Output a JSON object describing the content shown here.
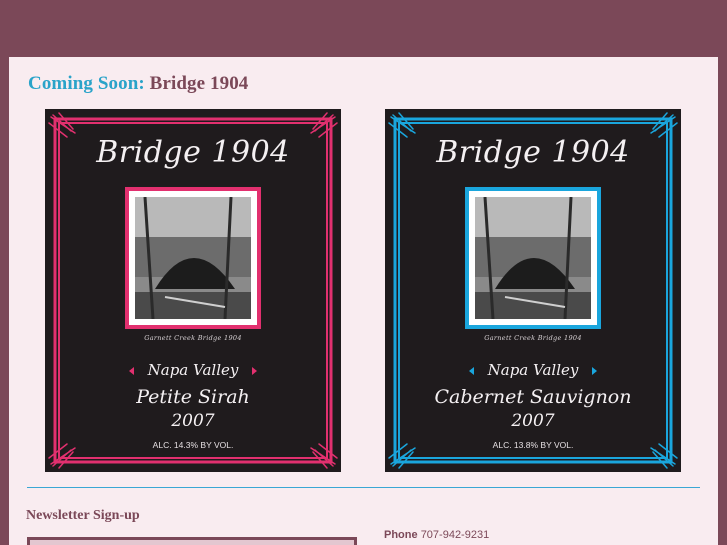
{
  "heading": {
    "prefix": "Coming Soon:",
    "name": "Bridge 1904"
  },
  "labels": [
    {
      "title": "Bridge 1904",
      "caption": "Garnett Creek Bridge 1904",
      "region": "Napa Valley",
      "varietal": "Petite Sirah",
      "vintage": "2007",
      "alc": "ALC. 14.3% BY VOL.",
      "accent": "#e2306f"
    },
    {
      "title": "Bridge 1904",
      "caption": "Garnett Creek Bridge 1904",
      "region": "Napa Valley",
      "varietal": "Cabernet Sauvignon",
      "vintage": "2007",
      "alc": "ALC. 13.8% BY VOL.",
      "accent": "#1aa6dd"
    }
  ],
  "newsletter": {
    "title": "Newsletter Sign-up"
  },
  "contact": {
    "phone_label": "Phone",
    "phone_number": "707-942-9231"
  },
  "colors": {
    "page_bg": "#7b4858",
    "content_bg": "#f9ecf0",
    "accent_blue": "#2aa3c9"
  }
}
